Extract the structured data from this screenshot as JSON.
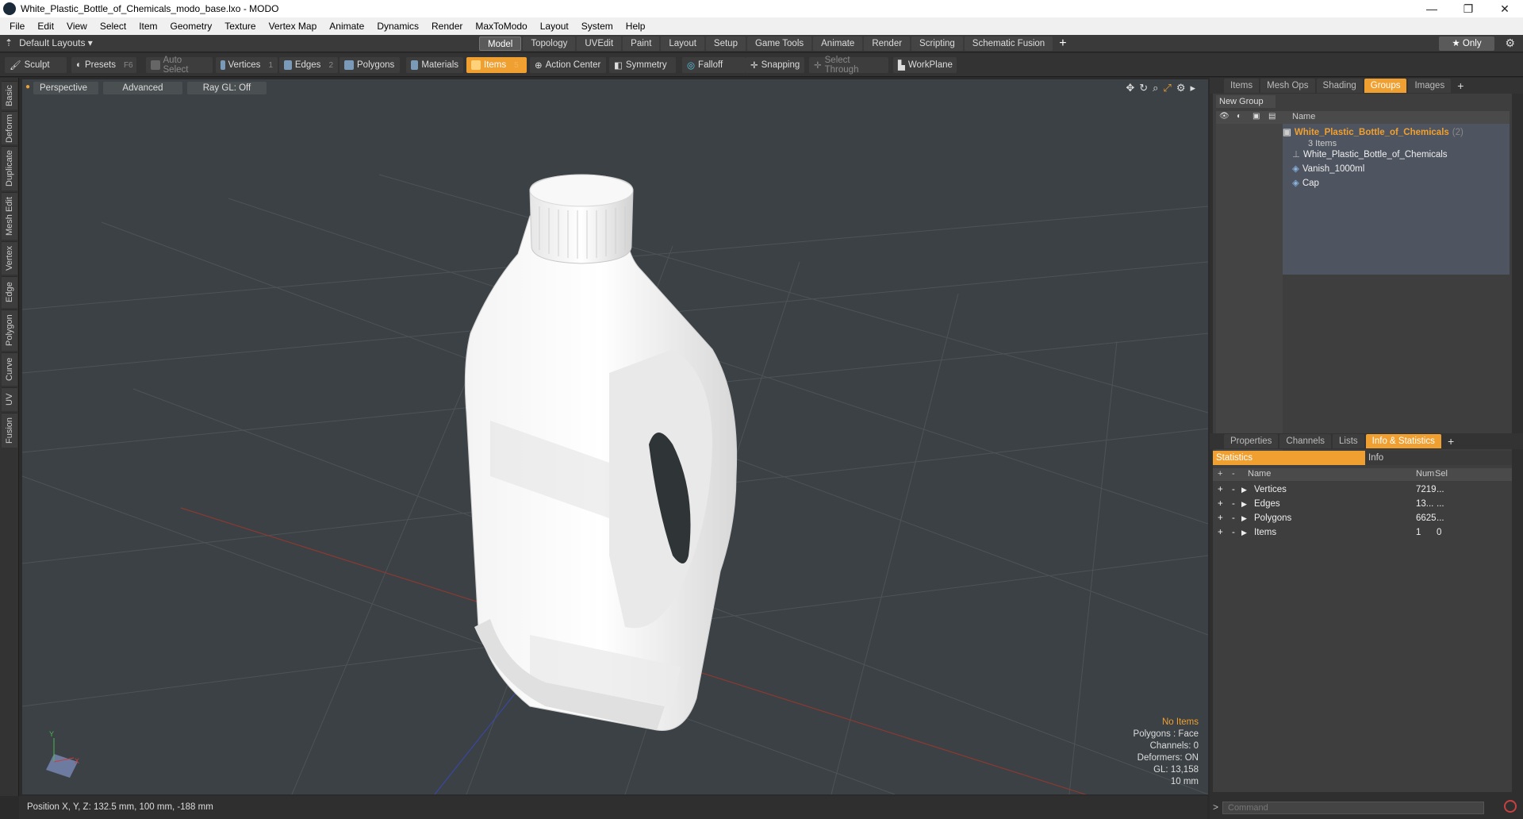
{
  "window": {
    "title": "White_Plastic_Bottle_of_Chemicals_modo_base.lxo - MODO",
    "min": "—",
    "max": "❐",
    "close": "✕"
  },
  "menu": [
    "File",
    "Edit",
    "View",
    "Select",
    "Item",
    "Geometry",
    "Texture",
    "Vertex Map",
    "Animate",
    "Dynamics",
    "Render",
    "MaxToModo",
    "Layout",
    "System",
    "Help"
  ],
  "layout": {
    "label": "Default Layouts ▾",
    "tabs": [
      "Model",
      "Topology",
      "UVEdit",
      "Paint",
      "Layout",
      "Setup",
      "Game Tools",
      "Animate",
      "Render",
      "Scripting",
      "Schematic Fusion"
    ],
    "active_tab": "Model",
    "plus": "+",
    "only": "★  Only",
    "gear": "⚙"
  },
  "toolbar": {
    "sculpt": "Sculpt",
    "presets": "Presets",
    "presets_key": "F6",
    "auto_select": "Auto Select",
    "vertices": "Vertices",
    "vertices_key": "1",
    "edges": "Edges",
    "edges_key": "2",
    "polygons": "Polygons",
    "materials": "Materials",
    "items": "Items",
    "items_key": "5",
    "action_center": "Action Center",
    "symmetry": "Symmetry",
    "falloff": "Falloff",
    "snapping": "Snapping",
    "select_through": "Select Through",
    "workplane": "WorkPlane"
  },
  "left_tabs": [
    "Basic",
    "Deform",
    "Duplicate",
    "Mesh Edit",
    "Vertex",
    "Edge",
    "Polygon",
    "Curve",
    "UV",
    "Fusion"
  ],
  "viewport": {
    "perspective": "Perspective",
    "advanced": "Advanced",
    "raygl": "Ray GL: Off",
    "info": {
      "no_items": "No Items",
      "polygons": "Polygons : Face",
      "channels": "Channels: 0",
      "deformers": "Deformers: ON",
      "gl": "GL: 13,158",
      "scale": "10 mm"
    },
    "axis_x": "X",
    "axis_y": "Y"
  },
  "status": {
    "position": "Position X, Y, Z:   132.5 mm, 100 mm, -188 mm"
  },
  "groups_panel": {
    "tabs": [
      "Items",
      "Mesh Ops",
      "Shading",
      "Groups",
      "Images"
    ],
    "active": "Groups",
    "plus": "+",
    "new_group": "New Group",
    "name_header": "Name",
    "group_name": "White_Plastic_Bottle_of_Chemicals",
    "group_count": "(2)",
    "group_sub": "3 Items",
    "children": [
      "White_Plastic_Bottle_of_Chemicals",
      "Vanish_1000ml",
      "Cap"
    ]
  },
  "props_panel": {
    "tabs": [
      "Properties",
      "Channels",
      "Lists",
      "Info & Statistics"
    ],
    "active": "Info & Statistics",
    "plus": "+",
    "sub_tabs": [
      "Statistics",
      "Info"
    ],
    "columns": [
      "Name",
      "Num",
      "Sel"
    ],
    "rows": [
      {
        "name": "Vertices",
        "num": "7219",
        "sel": "..."
      },
      {
        "name": "Edges",
        "num": "13...",
        "sel": "..."
      },
      {
        "name": "Polygons",
        "num": "6625",
        "sel": "..."
      },
      {
        "name": "Items",
        "num": "1",
        "sel": "0"
      }
    ],
    "command_placeholder": "Command"
  }
}
